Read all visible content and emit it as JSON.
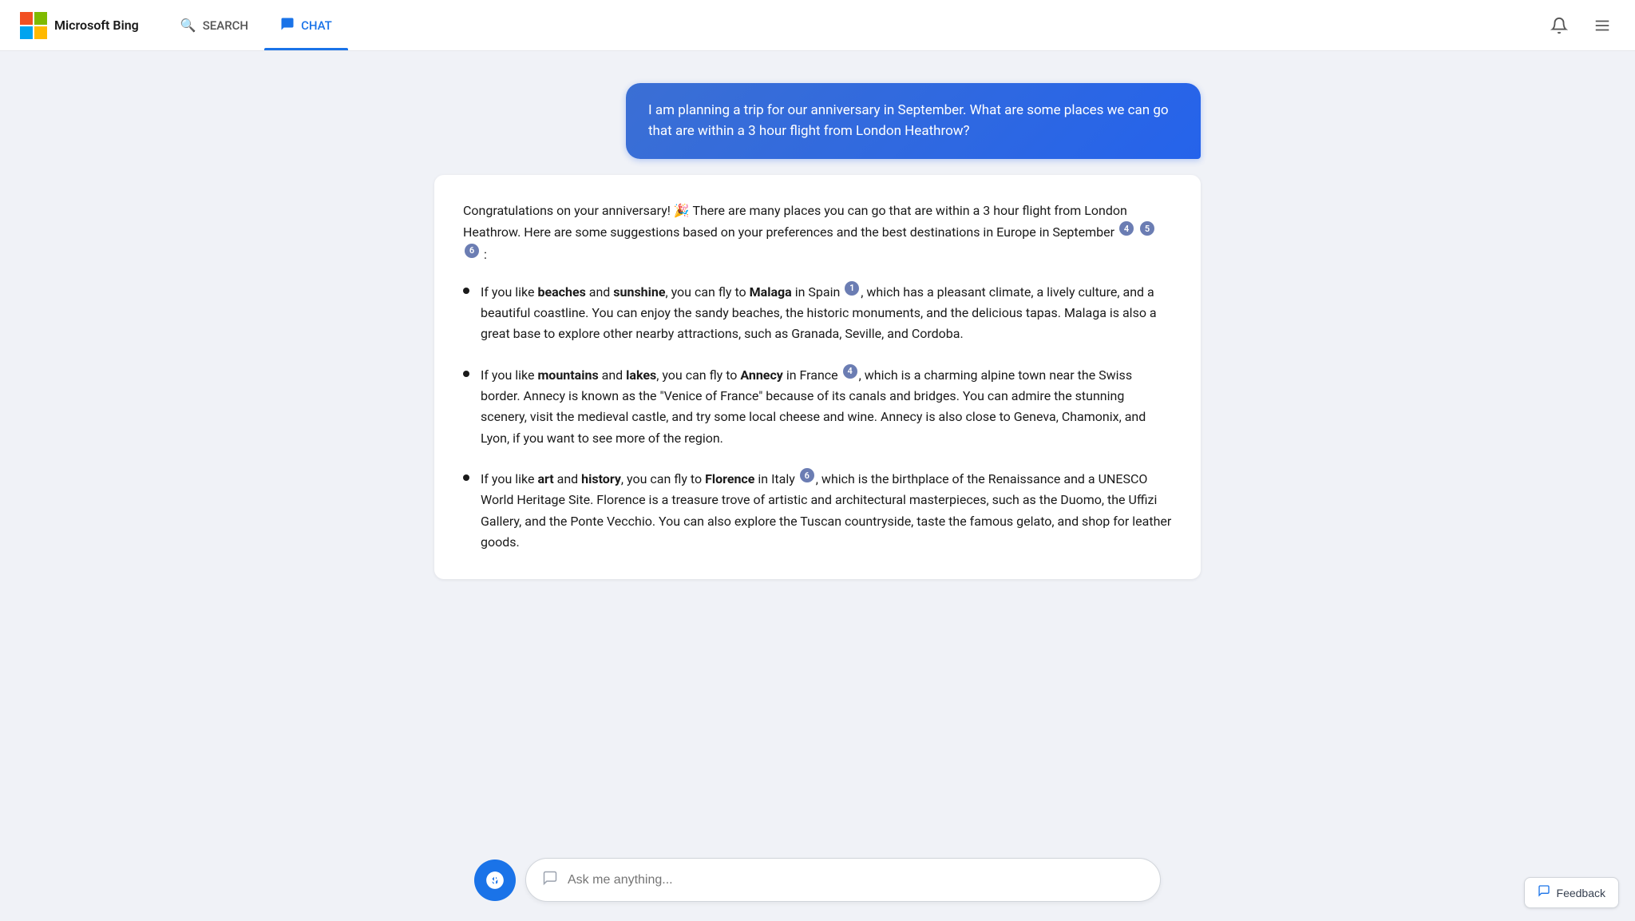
{
  "header": {
    "logo_text": "Microsoft Bing",
    "nav": [
      {
        "id": "search",
        "label": "SEARCH",
        "icon": "🔍",
        "active": false
      },
      {
        "id": "chat",
        "label": "CHAT",
        "icon": "💬",
        "active": true
      }
    ],
    "right_icons": [
      {
        "id": "notification",
        "label": "Notifications",
        "icon": "🔔"
      },
      {
        "id": "menu",
        "label": "Menu",
        "icon": "☰"
      }
    ]
  },
  "user_message": {
    "text": "I am planning a trip for our anniversary in September. What are some places we can go that are within a 3 hour flight from London Heathrow?"
  },
  "ai_response": {
    "intro": "Congratulations on your anniversary! 🎉 There are many places you can go that are within a 3 hour flight from London Heathrow. Here are some suggestions based on your preferences and the best destinations in Europe in September",
    "intro_citations": [
      "4",
      "5",
      "6"
    ],
    "items": [
      {
        "id": 1,
        "bold_words": [
          "beaches",
          "sunshine"
        ],
        "connector": "and",
        "destination": "Malaga",
        "location": "in Spain",
        "citation": "1",
        "description": ", which has a pleasant climate, a lively culture, and a beautiful coastline. You can enjoy the sandy beaches, the historic monuments, and the delicious tapas. Malaga is also a great base to explore other nearby attractions, such as Granada, Seville, and Cordoba."
      },
      {
        "id": 2,
        "bold_words": [
          "mountains",
          "lakes"
        ],
        "connector": "and",
        "destination": "Annecy",
        "location": "in France",
        "citation": "4",
        "description": ", which is a charming alpine town near the Swiss border. Annecy is known as the \"Venice of France\" because of its canals and bridges. You can admire the stunning scenery, visit the medieval castle, and try some local cheese and wine. Annecy is also close to Geneva, Chamonix, and Lyon, if you want to see more of the region."
      },
      {
        "id": 3,
        "bold_words": [
          "art",
          "history"
        ],
        "connector": "and",
        "destination": "Florence",
        "location": "in Italy",
        "citation": "6",
        "description": ", which is the birthplace of the Renaissance and a UNESCO World Heritage Site. Florence is a treasure trove of artistic and architectural masterpieces, such as the Duomo, the Uffizi Gallery, and the Ponte Vecchio. You can also explore the Tuscan countryside, taste the famous gelato, and shop for leather goods."
      }
    ]
  },
  "input": {
    "placeholder": "Ask me anything...",
    "icon": "💬"
  },
  "feedback": {
    "label": "Feedback",
    "icon": "📋"
  }
}
